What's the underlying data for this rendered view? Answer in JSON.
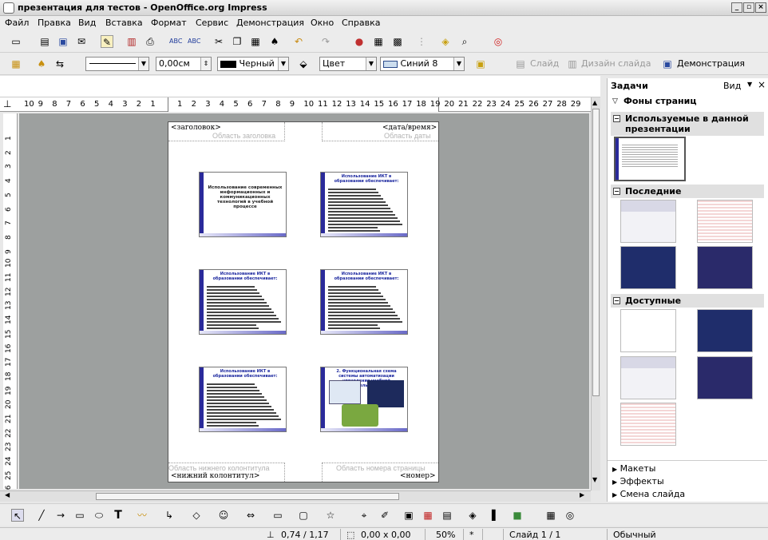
{
  "window": {
    "title": "презентация для тестов - OpenOffice.org Impress"
  },
  "menu": [
    "Файл",
    "Правка",
    "Вид",
    "Вставка",
    "Формат",
    "Сервис",
    "Демонстрация",
    "Окно",
    "Справка"
  ],
  "linebar": {
    "width_value": "0,00см",
    "line_color": "Черный",
    "fill_mode": "Цвет",
    "fill_color": "Синий 8",
    "slide_btn": "Слайд",
    "design_btn": "Дизайн слайда",
    "show_btn": "Демонстрация"
  },
  "ruler": {
    "h_labels": [
      "10",
      "9",
      "8",
      "7",
      "6",
      "5",
      "4",
      "3",
      "2",
      "1",
      "1",
      "2",
      "3",
      "4",
      "5",
      "6",
      "7",
      "8",
      "9",
      "10",
      "11",
      "12",
      "13",
      "14",
      "15",
      "16",
      "17",
      "18",
      "19",
      "20",
      "21",
      "22",
      "23",
      "24",
      "25",
      "26",
      "27",
      "28",
      "29"
    ],
    "v_labels": [
      "1",
      "2",
      "3",
      "4",
      "5",
      "6",
      "7",
      "8",
      "9",
      "10",
      "11",
      "12",
      "13",
      "14",
      "15",
      "16",
      "17",
      "18",
      "19",
      "20",
      "21",
      "22",
      "23",
      "24",
      "25",
      "26"
    ]
  },
  "handout": {
    "header": "<заголовок>",
    "header_area": "Область заголовка",
    "date": "<дата/время>",
    "date_area": "Область даты",
    "footer_area": "Область нижнего колонтитула",
    "footer": "<нижний колонтитул>",
    "number_area": "Область номера страницы",
    "number": "<номер>",
    "slides": [
      {
        "title": "Использование современных информационных и коммуникационных технологий в учебной процессе"
      },
      {
        "title": "Использование ИКТ в образовании обеспечивает:"
      },
      {
        "title": "Использование ИКТ в образовании обеспечивает:"
      },
      {
        "title": "Использование ИКТ в образовании обеспечивает:"
      },
      {
        "title": "Использование ИКТ в образовании обеспечивает:"
      },
      {
        "title": "2. Функциональная схема системы автоматизации управления учебной деятельностью"
      }
    ]
  },
  "panel": {
    "title": "Задачи",
    "view": "Вид",
    "category": "Фоны страниц",
    "sections": [
      {
        "label": "Используемые в данной презентации"
      },
      {
        "label": "Последние"
      },
      {
        "label": "Доступные"
      }
    ],
    "collapsed": [
      "Макеты",
      "Эффекты",
      "Смена слайда"
    ]
  },
  "status": {
    "position": "0,74 / 1,17",
    "size": "0,00 x 0,00",
    "zoom": "50%",
    "modified": "*",
    "slide": "Слайд 1 / 1",
    "layout": "Обычный"
  },
  "colors": {
    "accent": "#2a2a9a",
    "navy": "#1f2d6b",
    "pink": "#f4d6d6"
  }
}
